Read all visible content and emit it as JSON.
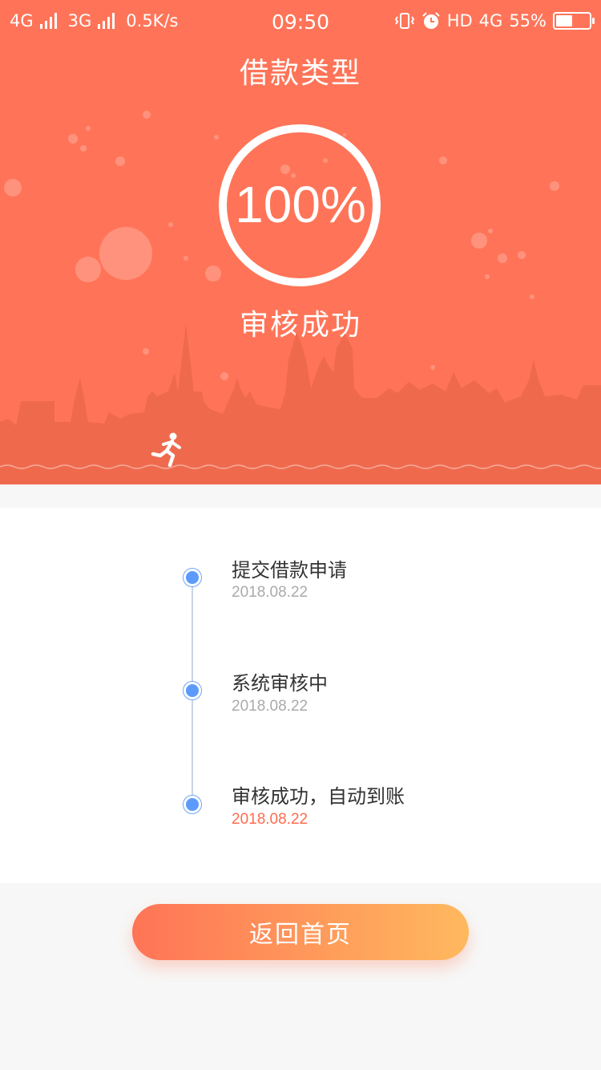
{
  "status_bar": {
    "network_1": "4G",
    "network_2": "3G",
    "speed": "0.5K/s",
    "time": "09:50",
    "hd": "HD",
    "network_3": "4G",
    "battery": "55%",
    "battery_level": 0.55
  },
  "header": {
    "title": "借款类型"
  },
  "progress": {
    "value": "100%",
    "status": "审核成功"
  },
  "timeline": {
    "steps": [
      {
        "title": "提交借款申请",
        "date": "2018.08.22"
      },
      {
        "title": "系统审核中",
        "date": "2018.08.22"
      },
      {
        "title": "审核成功，自动到账",
        "date": "2018.08.22"
      }
    ]
  },
  "actions": {
    "home_label": "返回首页"
  },
  "colors": {
    "hero_background": "#ff7458",
    "skyline": "#ef6a4d",
    "timeline_dot": "#5c9bfc",
    "active_date": "#ff6b4e",
    "button_gradient_start": "#ff7456",
    "button_gradient_end": "#ffb95e"
  },
  "icons": {
    "runner": "running-person-icon",
    "vibrate": "vibrate-icon",
    "alarm": "alarm-clock-icon",
    "battery": "battery-icon"
  }
}
